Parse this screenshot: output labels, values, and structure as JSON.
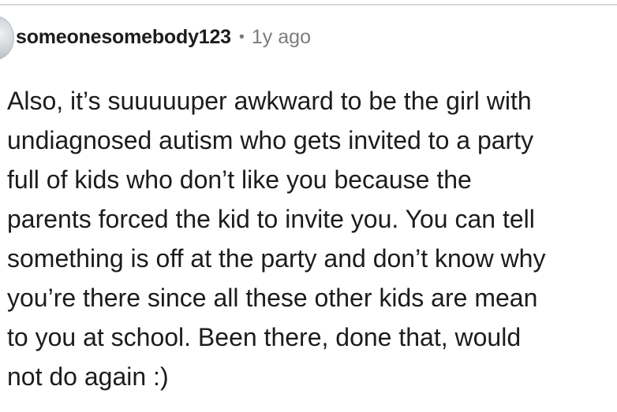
{
  "comment": {
    "author": "someonesomebody123",
    "separator": "•",
    "age": "1y ago",
    "body_lines": [
      "Also, it’s suuuuuper awkward to be the girl with",
      "undiagnosed autism who gets invited to a party",
      "full of kids who don’t like you because the",
      "parents forced the kid to invite you. You can tell",
      "something is off at the party and don’t know why",
      "you’re there since all these other kids are mean",
      "to you at school. Been there, done that, would",
      "not do again :)"
    ]
  },
  "colors": {
    "text": "#1c1c1c",
    "meta": "#7c7c7c",
    "divider": "#d7dadc",
    "background": "#ffffff"
  }
}
